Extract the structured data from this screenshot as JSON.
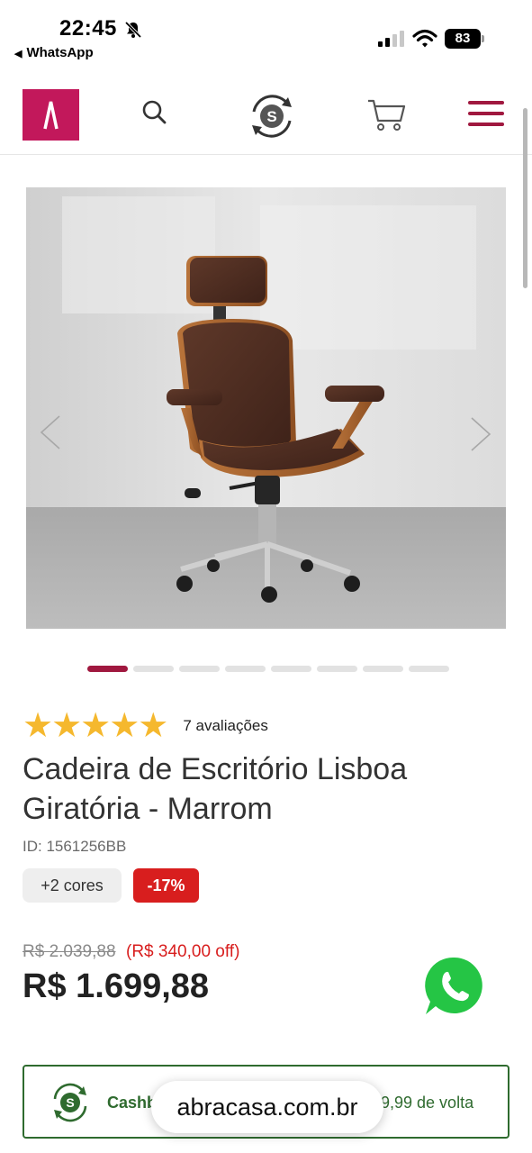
{
  "status_bar": {
    "time": "22:45",
    "back_app": "WhatsApp",
    "battery": "83"
  },
  "header": {
    "logo_icon": "brand-logo",
    "icons": [
      "search-icon",
      "cashback-icon",
      "cart-icon",
      "menu-icon"
    ],
    "brand_color": "#c2185b",
    "accent_color": "#a0183f"
  },
  "gallery": {
    "image_alt": "",
    "total_slides": 8,
    "active_slide": 1
  },
  "product": {
    "rating": 5,
    "stars": "★★★★★",
    "reviews": "7 avaliações",
    "title": "Cadeira de Escritório Lisboa Giratória - Marrom",
    "id": "ID: 1561256BB",
    "colors_badge": "+2 cores",
    "discount_badge": "-17%",
    "old_price": "R$ 2.039,88",
    "off_amount": "(R$ 340,00 off)",
    "price": "R$ 1.699,88"
  },
  "cashback": {
    "label": "Cashb",
    "value": "9,99 de volta"
  },
  "browser": {
    "url": "abracasa.com.br"
  }
}
